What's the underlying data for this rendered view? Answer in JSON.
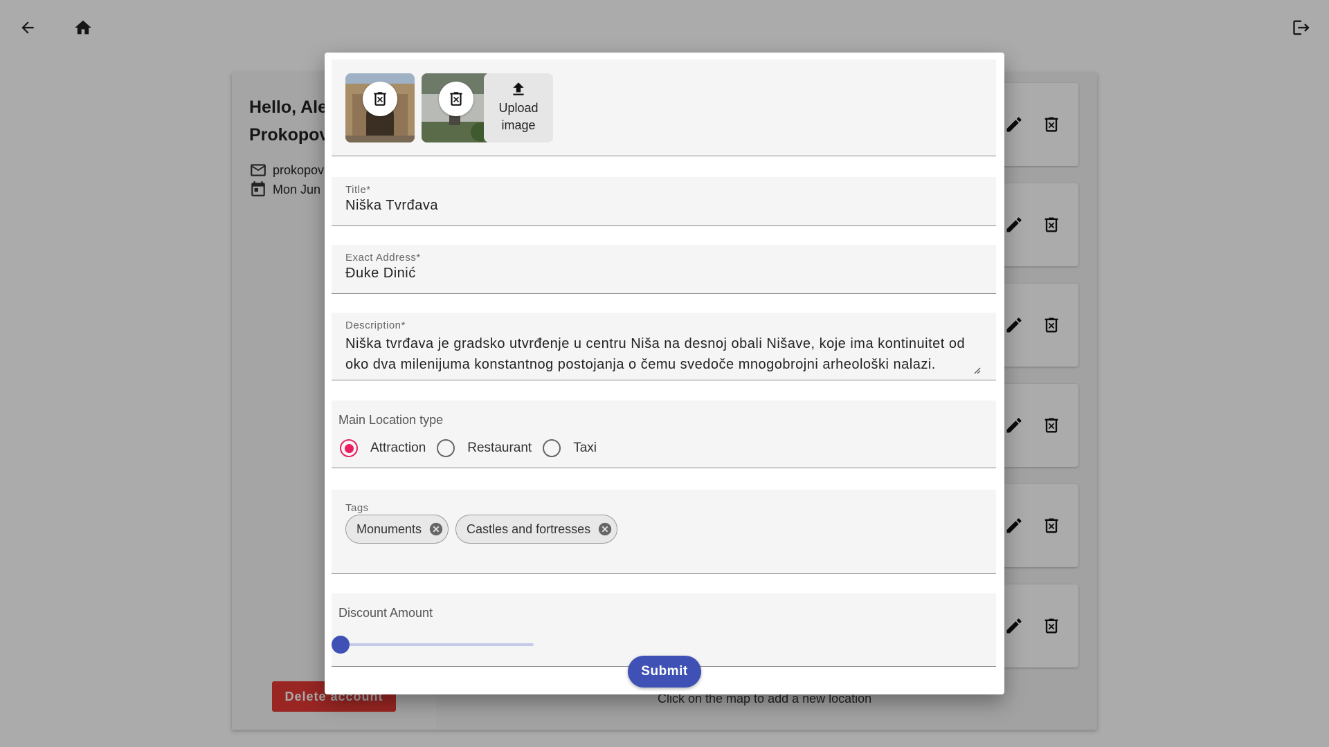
{
  "profile": {
    "greeting": "Hello, Ale",
    "surname": "Prokopov",
    "email": "prokopov",
    "date": "Mon Jun"
  },
  "delete_account_label": "Delete account",
  "map_hint": "Click on the map to add a new location",
  "dialog": {
    "upload_label": "Upload image",
    "title": {
      "label": "Title*",
      "value": "Niška Tvrđava"
    },
    "address": {
      "label": "Exact Address*",
      "value": "Đuke Dinić"
    },
    "description": {
      "label": "Description*",
      "value": "Niška tvrđava je gradsko utvrđenje u centru Niša na desnoj obali Nišave, koje ima kontinuitet od oko dva milenijuma konstantnog postojanja o čemu svedoče mnogobrojni arheološki nalazi."
    },
    "location_type": {
      "label": "Main Location type",
      "options": [
        "Attraction",
        "Restaurant",
        "Taxi"
      ],
      "selected": "Attraction"
    },
    "tags": {
      "label": "Tags",
      "items": [
        "Monuments",
        "Castles and fortresses"
      ]
    },
    "discount": {
      "label": "Discount Amount",
      "value": 0
    },
    "submit_label": "Submit"
  },
  "colors": {
    "accent_radio": "#e91e63",
    "primary": "#3f51b5",
    "danger": "#e53935"
  },
  "icons": [
    "back-arrow-icon",
    "home-icon",
    "logout-icon",
    "mail-icon",
    "calendar-icon",
    "edit-icon",
    "delete-icon",
    "upload-icon",
    "cancel-circle-icon"
  ]
}
